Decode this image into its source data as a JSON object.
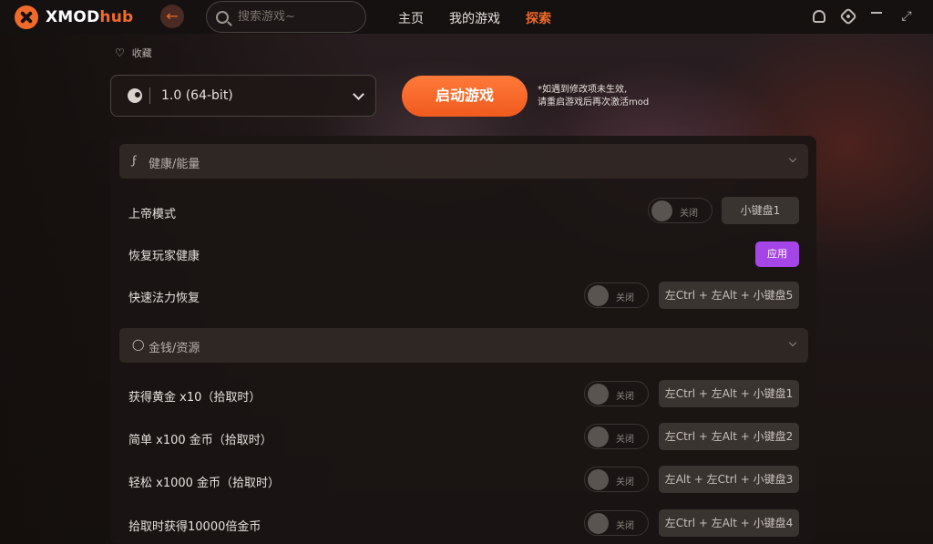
{
  "app": {
    "name_main": "XMOD",
    "name_accent": "hub"
  },
  "search": {
    "placeholder": "搜索游戏~"
  },
  "nav": {
    "items": [
      "主页",
      "我的游戏",
      "探索"
    ],
    "active_index": 2
  },
  "favorite": {
    "label": "收藏"
  },
  "version": {
    "label": "1.0 (64-bit)"
  },
  "launch": {
    "button_label": "启动游戏",
    "note_line1": "*如遇到修改项未生效,",
    "note_line2": "请重启游戏后再次激活mod"
  },
  "sections": [
    {
      "title": "健康/能量",
      "icon": "lightning-icon",
      "rows": [
        {
          "label": "上帝模式",
          "control": "toggle",
          "state": "关闭",
          "hotkey": "小键盘1"
        },
        {
          "label": "恢复玩家健康",
          "control": "button",
          "button_label": "应用"
        },
        {
          "label": "快速法力恢复",
          "control": "toggle",
          "state": "关闭",
          "hotkey": "左Ctrl + 左Alt + 小键盘5"
        }
      ]
    },
    {
      "title": "金钱/资源",
      "icon": "money-bag-icon",
      "rows": [
        {
          "label": "获得黄金 x10（拾取时）",
          "control": "toggle",
          "state": "关闭",
          "hotkey": "左Ctrl + 左Alt + 小键盘1"
        },
        {
          "label": "简单 x100 金币（拾取时）",
          "control": "toggle",
          "state": "关闭",
          "hotkey": "左Ctrl + 左Alt + 小键盘2"
        },
        {
          "label": "轻松 x1000 金币（拾取时）",
          "control": "toggle",
          "state": "关闭",
          "hotkey": "左Alt + 左Ctrl + 小键盘3"
        },
        {
          "label": "拾取时获得10000倍金币",
          "control": "toggle",
          "state": "关闭",
          "hotkey": "左Ctrl + 左Alt + 小键盘4"
        }
      ]
    }
  ],
  "colors": {
    "accent": "#f06a2a",
    "apply": "#a545e8",
    "background": "#181311"
  }
}
